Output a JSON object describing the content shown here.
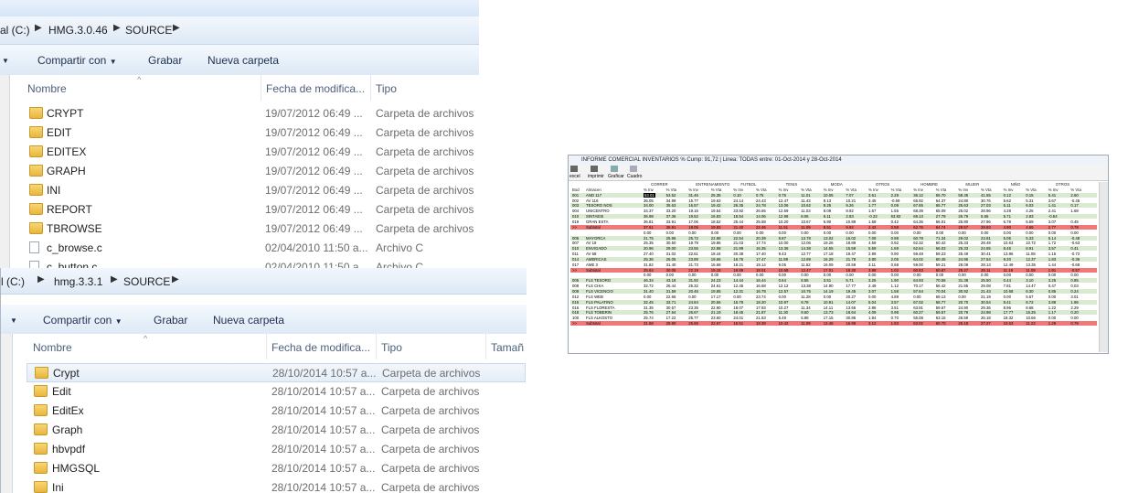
{
  "explorer_top": {
    "path": [
      "al (C:)",
      "HMG.3.0.46",
      "SOURCE"
    ],
    "toolbar": {
      "share": "Compartir con",
      "burn": "Grabar",
      "new_folder": "Nueva carpeta"
    },
    "columns": {
      "name": "Nombre",
      "date": "Fecha de modifica...",
      "type": "Tipo"
    },
    "items": [
      {
        "name": "CRYPT",
        "date": "19/07/2012 06:49 ...",
        "type": "Carpeta de archivos",
        "icon": "folder-icon"
      },
      {
        "name": "EDIT",
        "date": "19/07/2012 06:49 ...",
        "type": "Carpeta de archivos",
        "icon": "folder-icon"
      },
      {
        "name": "EDITEX",
        "date": "19/07/2012 06:49 ...",
        "type": "Carpeta de archivos",
        "icon": "folder-icon"
      },
      {
        "name": "GRAPH",
        "date": "19/07/2012 06:49 ...",
        "type": "Carpeta de archivos",
        "icon": "folder-icon"
      },
      {
        "name": "INI",
        "date": "19/07/2012 06:49 ...",
        "type": "Carpeta de archivos",
        "icon": "folder-icon"
      },
      {
        "name": "REPORT",
        "date": "19/07/2012 06:49 ...",
        "type": "Carpeta de archivos",
        "icon": "folder-icon"
      },
      {
        "name": "TBROWSE",
        "date": "19/07/2012 06:49 ...",
        "type": "Carpeta de archivos",
        "icon": "folder-icon"
      },
      {
        "name": "c_browse.c",
        "date": "02/04/2010 11:50 a...",
        "type": "Archivo C",
        "icon": "file-icon"
      },
      {
        "name": "c_button.c",
        "date": "02/04/2010 11:50 a...",
        "type": "Archivo C",
        "icon": "file-icon"
      }
    ]
  },
  "explorer_bottom": {
    "path": [
      "l (C:)",
      "hmg.3.3.1",
      "SOURCE"
    ],
    "toolbar": {
      "share": "Compartir con",
      "burn": "Grabar",
      "new_folder": "Nueva carpeta"
    },
    "columns": {
      "name": "Nombre",
      "date": "Fecha de modifica...",
      "type": "Tipo",
      "size": "Tamañ"
    },
    "items": [
      {
        "name": "Crypt",
        "date": "28/10/2014 10:57 a...",
        "type": "Carpeta de archivos",
        "icon": "folder-icon"
      },
      {
        "name": "Edit",
        "date": "28/10/2014 10:57 a...",
        "type": "Carpeta de archivos",
        "icon": "folder-icon"
      },
      {
        "name": "EditEx",
        "date": "28/10/2014 10:57 a...",
        "type": "Carpeta de archivos",
        "icon": "folder-icon"
      },
      {
        "name": "Graph",
        "date": "28/10/2014 10:57 a...",
        "type": "Carpeta de archivos",
        "icon": "folder-icon"
      },
      {
        "name": "hbvpdf",
        "date": "28/10/2014 10:57 a...",
        "type": "Carpeta de archivos",
        "icon": "folder-icon"
      },
      {
        "name": "HMGSQL",
        "date": "28/10/2014 10:57 a...",
        "type": "Carpeta de archivos",
        "icon": "folder-icon"
      },
      {
        "name": "Ini",
        "date": "28/10/2014 10:57 a...",
        "type": "Carpeta de archivos",
        "icon": "folder-icon"
      }
    ]
  },
  "report_window": {
    "title": "INFORME COMERCIAL INVENTARIOS    % Cump: 91,72 | Linea: TODAS  entre: 01-Oct-2014 y 28-Oct-2014",
    "toolbar": [
      "excel",
      "imprimir",
      "Graficar",
      "Cuadro"
    ],
    "groups": [
      "CORRER",
      "ENTRENAMIENTO",
      "FUTBOL",
      "TENIS",
      "MODA",
      "OTROS",
      "HOMBRE",
      "MUJER",
      "NIÑO",
      "OTROS"
    ],
    "subheaders": [
      "Bod",
      "Almacen",
      "% Inv",
      "% Vta"
    ],
    "rows": [
      {
        "style": "g",
        "cells": [
          "001",
          "AND 117",
          "53.01",
          "53.52",
          "31.46",
          "25.35",
          "0.10",
          "0.75",
          "0.75",
          "11.01",
          "10.05",
          "7.07",
          "3.61",
          "2.29",
          "36.12",
          "55.70",
          "58.35",
          "41.55",
          "0.12",
          "0.15",
          "5.41",
          "2.60"
        ]
      },
      {
        "style": "w",
        "cells": [
          "002",
          "AV 116",
          "36.05",
          "34.99",
          "15.77",
          "19.63",
          "24.14",
          "24.43",
          "12.47",
          "11.43",
          "8.13",
          "10.21",
          "3.45",
          "-0.69",
          "65.92",
          "64.37",
          "24.80",
          "30.76",
          "5.62",
          "5.31",
          "3.67",
          "-0.45"
        ]
      },
      {
        "style": "g",
        "cells": [
          "003",
          "TESORO NOS",
          "34.00",
          "35.63",
          "16.57",
          "19.42",
          "26.35",
          "24.78",
          "13.06",
          "10.62",
          "8.25",
          "9.26",
          "1.77",
          "0.09",
          "67.65",
          "65.77",
          "25.63",
          "27.03",
          "5.11",
          "6.03",
          "1.41",
          "0.17"
        ]
      },
      {
        "style": "w",
        "cells": [
          "004",
          "UNICENTRO",
          "34.37",
          "33.20",
          "19.16",
          "19.54",
          "23.92",
          "26.65",
          "12.59",
          "11.03",
          "8.09",
          "8.92",
          "1.67",
          "1.55",
          "68.39",
          "65.09",
          "25.02",
          "28.96",
          "4.28",
          "4.26",
          "2.41",
          "1.68"
        ]
      },
      {
        "style": "g",
        "cells": [
          "010",
          "SINTAESI",
          "36.98",
          "37.36",
          "19.52",
          "16.83",
          "18.54",
          "14.06",
          "12.98",
          "8.06",
          "6.11",
          "2.83",
          "-0.22",
          "63.82",
          "69.13",
          "27.79",
          "25.79",
          "5.65",
          "5.71",
          "2.83",
          "-0.54"
        ]
      },
      {
        "style": "w",
        "cells": [
          "019",
          "GRAN ESTA",
          "36.81",
          "33.91",
          "17.06",
          "18.52",
          "25.44",
          "25.58",
          "10.20",
          "10.67",
          "6.90",
          "10.89",
          "1.58",
          "0.42",
          "64.35",
          "66.01",
          "25.80",
          "27.96",
          "6.78",
          "5.59",
          "3.07",
          "0.45"
        ]
      },
      {
        "style": "r",
        "cells": [
          ">>",
          "Subtotal",
          "37.61",
          "36.91",
          "18.05",
          "19.83",
          "21.40",
          "22.46",
          "11.51",
          "11.09",
          "8.51",
          "9.92",
          "2.42",
          "0.58",
          "62.76",
          "64.74",
          "29.57",
          "29.83",
          "4.90",
          "4.65",
          "2.77",
          "0.78"
        ]
      },
      {
        "style": "w",
        "cells": [
          "",
          "",
          "0.00",
          "0.00",
          "0.00",
          "0.00",
          "0.00",
          "0.00",
          "0.00",
          "0.00",
          "0.00",
          "0.00",
          "0.00",
          "0.00",
          "0.00",
          "0.00",
          "0.00",
          "0.00",
          "0.00",
          "0.00",
          "0.00",
          "0.00"
        ]
      },
      {
        "style": "g",
        "cells": [
          "006",
          "MAYORCA",
          "21.75",
          "25.95",
          "25.72",
          "22.88",
          "22.54",
          "20.39",
          "8.87",
          "13.78",
          "13.02",
          "16.02",
          "7.09",
          "0.98",
          "60.79",
          "71.34",
          "29.02",
          "23.81",
          "5.05",
          "5.33",
          "5.14",
          "-0.48"
        ]
      },
      {
        "style": "w",
        "cells": [
          "007",
          "AV 19",
          "25.35",
          "30.50",
          "19.79",
          "19.86",
          "21.03",
          "17.74",
          "10.00",
          "12.06",
          "19.26",
          "18.89",
          "4.59",
          "0.92",
          "62.32",
          "60.42",
          "25.33",
          "28.49",
          "10.63",
          "10.72",
          "1.72",
          "-0.63"
        ]
      },
      {
        "style": "g",
        "cells": [
          "010",
          "ENVIGADO",
          "20.96",
          "29.00",
          "23.55",
          "22.88",
          "21.99",
          "16.35",
          "13.36",
          "14.38",
          "14.55",
          "15.59",
          "5.59",
          "1.69",
          "62.64",
          "66.03",
          "25.33",
          "24.65",
          "8.45",
          "8.91",
          "3.57",
          "0.41"
        ]
      },
      {
        "style": "w",
        "cells": [
          "011",
          "AV 68",
          "27.40",
          "31.02",
          "22.61",
          "18.44",
          "20.38",
          "17.40",
          "9.43",
          "12.77",
          "17.18",
          "19.47",
          "2.99",
          "0.90",
          "59.48",
          "59.23",
          "25.49",
          "30.41",
          "13.86",
          "11.08",
          "1.15",
          "-0.72"
        ]
      },
      {
        "style": "g",
        "cells": [
          "014",
          "AMERICAS",
          "25.36",
          "26.05",
          "23.89",
          "19.66",
          "16.76",
          "17.47",
          "11.89",
          "12.89",
          "16.29",
          "21.78",
          "3.80",
          "2.05",
          "64.02",
          "60.45",
          "24.95",
          "27.54",
          "9.20",
          "12.37",
          "1.83",
          "-0.36"
        ]
      },
      {
        "style": "w",
        "cells": [
          "017",
          "AME 3",
          "31.82",
          "31.40",
          "21.73",
          "15.68",
          "18.21",
          "19.14",
          "9.05",
          "11.52",
          "16.09",
          "20.59",
          "3.11",
          "0.68",
          "59.00",
          "59.21",
          "28.08",
          "28.13",
          "12.49",
          "13.35",
          "1.44",
          "-0.68"
        ]
      },
      {
        "style": "r",
        "cells": [
          ">>",
          "Subtotal",
          "25.84",
          "30.05",
          "22.19",
          "19.15",
          "19.89",
          "18.01",
          "10.58",
          "12.47",
          "17.01",
          "18.30",
          "3.98",
          "1.02",
          "60.83",
          "60.87",
          "26.27",
          "28.11",
          "11.19",
          "11.09",
          "1.91",
          "-0.57"
        ]
      },
      {
        "style": "w",
        "cells": [
          "",
          "",
          "0.00",
          "0.00",
          "0.00",
          "0.00",
          "0.00",
          "0.00",
          "0.00",
          "0.00",
          "0.00",
          "0.00",
          "0.00",
          "0.00",
          "0.00",
          "0.00",
          "0.00",
          "0.00",
          "0.00",
          "0.00",
          "0.00",
          "0.00"
        ]
      },
      {
        "style": "g",
        "cells": [
          "005",
          "FLS TESORO",
          "46.34",
          "43.18",
          "31.92",
          "24.23",
          "14.44",
          "16.44",
          "0.64",
          "8.55",
          "3.51",
          "5.71",
          "3.25",
          "1.90",
          "64.93",
          "70.56",
          "31.38",
          "25.50",
          "0.44",
          "3.10",
          "3.25",
          "0.85"
        ]
      },
      {
        "style": "w",
        "cells": [
          "008",
          "FLS CHIA",
          "32.72",
          "26.44",
          "25.32",
          "24.61",
          "12.45",
          "16.68",
          "12.12",
          "13.38",
          "14.90",
          "17.77",
          "2.49",
          "1.12",
          "70.17",
          "56.42",
          "21.55",
          "29.08",
          "7.81",
          "14.47",
          "0.47",
          "0.03"
        ]
      },
      {
        "style": "g",
        "cells": [
          "009",
          "FLS VICENCIO",
          "31.40",
          "31.59",
          "20.45",
          "19.85",
          "12.31",
          "16.79",
          "12.57",
          "10.75",
          "14.19",
          "19.45",
          "3.07",
          "1.58",
          "57.64",
          "70.04",
          "30.92",
          "21.43",
          "10.58",
          "8.30",
          "0.85",
          "0.24"
        ]
      },
      {
        "style": "w",
        "cells": [
          "012",
          "FLS WEB",
          "0.00",
          "22.65",
          "0.00",
          "17.17",
          "0.00",
          "23.74",
          "0.00",
          "11.28",
          "0.00",
          "20.27",
          "0.00",
          "4.89",
          "0.00",
          "69.13",
          "0.00",
          "21.19",
          "0.00",
          "5.67",
          "0.00",
          "3.01"
        ]
      },
      {
        "style": "g",
        "cells": [
          "015",
          "FLS PALATINO",
          "32.45",
          "33.71",
          "24.84",
          "20.56",
          "15.79",
          "18.20",
          "10.97",
          "9.78",
          "10.91",
          "14.07",
          "5.04",
          "3.57",
          "67.02",
          "58.77",
          "20.70",
          "30.54",
          "8.41",
          "8.72",
          "3.88",
          "1.96"
        ]
      },
      {
        "style": "w",
        "cells": [
          "016",
          "FLS FLORESTA",
          "31.35",
          "30.57",
          "23.35",
          "22.90",
          "18.07",
          "17.93",
          "10.27",
          "11.34",
          "14.11",
          "13.66",
          "2.86",
          "3.51",
          "63.91",
          "59.67",
          "24.90",
          "29.36",
          "8.96",
          "8.68",
          "1.22",
          "2.29"
        ]
      },
      {
        "style": "g",
        "cells": [
          "018",
          "FLS TOBERIN",
          "25.76",
          "27.64",
          "26.67",
          "21.19",
          "18.45",
          "21.87",
          "11.30",
          "9.60",
          "13.73",
          "18.64",
          "4.09",
          "0.98",
          "60.27",
          "59.57",
          "20.79",
          "24.98",
          "17.77",
          "15.25",
          "1.17",
          "0.20"
        ]
      },
      {
        "style": "w",
        "cells": [
          "100",
          "FLS ALKOSTO",
          "25.74",
          "17.22",
          "25.77",
          "23.60",
          "24.01",
          "21.63",
          "5.49",
          "5.98",
          "17.15",
          "30.86",
          "1.84",
          "0.70",
          "55.08",
          "63.15",
          "26.59",
          "26.18",
          "18.32",
          "10.66",
          "0.00",
          "0.00"
        ]
      },
      {
        "style": "r",
        "cells": [
          ">>",
          "Subtotal",
          "31.58",
          "29.90",
          "25.69",
          "22.67",
          "15.51",
          "18.38",
          "10.42",
          "11.09",
          "13.48",
          "16.99",
          "3.12",
          "1.93",
          "63.02",
          "60.70",
          "25.18",
          "27.27",
          "10.63",
          "11.23",
          "1.29",
          "0.79"
        ]
      }
    ]
  },
  "colors": {
    "green_row": "#d9ead0",
    "red_row": "#f07878",
    "white_row": "#ffffff",
    "explorer_bar": "#dce8f5",
    "folder": "#e8b53e"
  }
}
